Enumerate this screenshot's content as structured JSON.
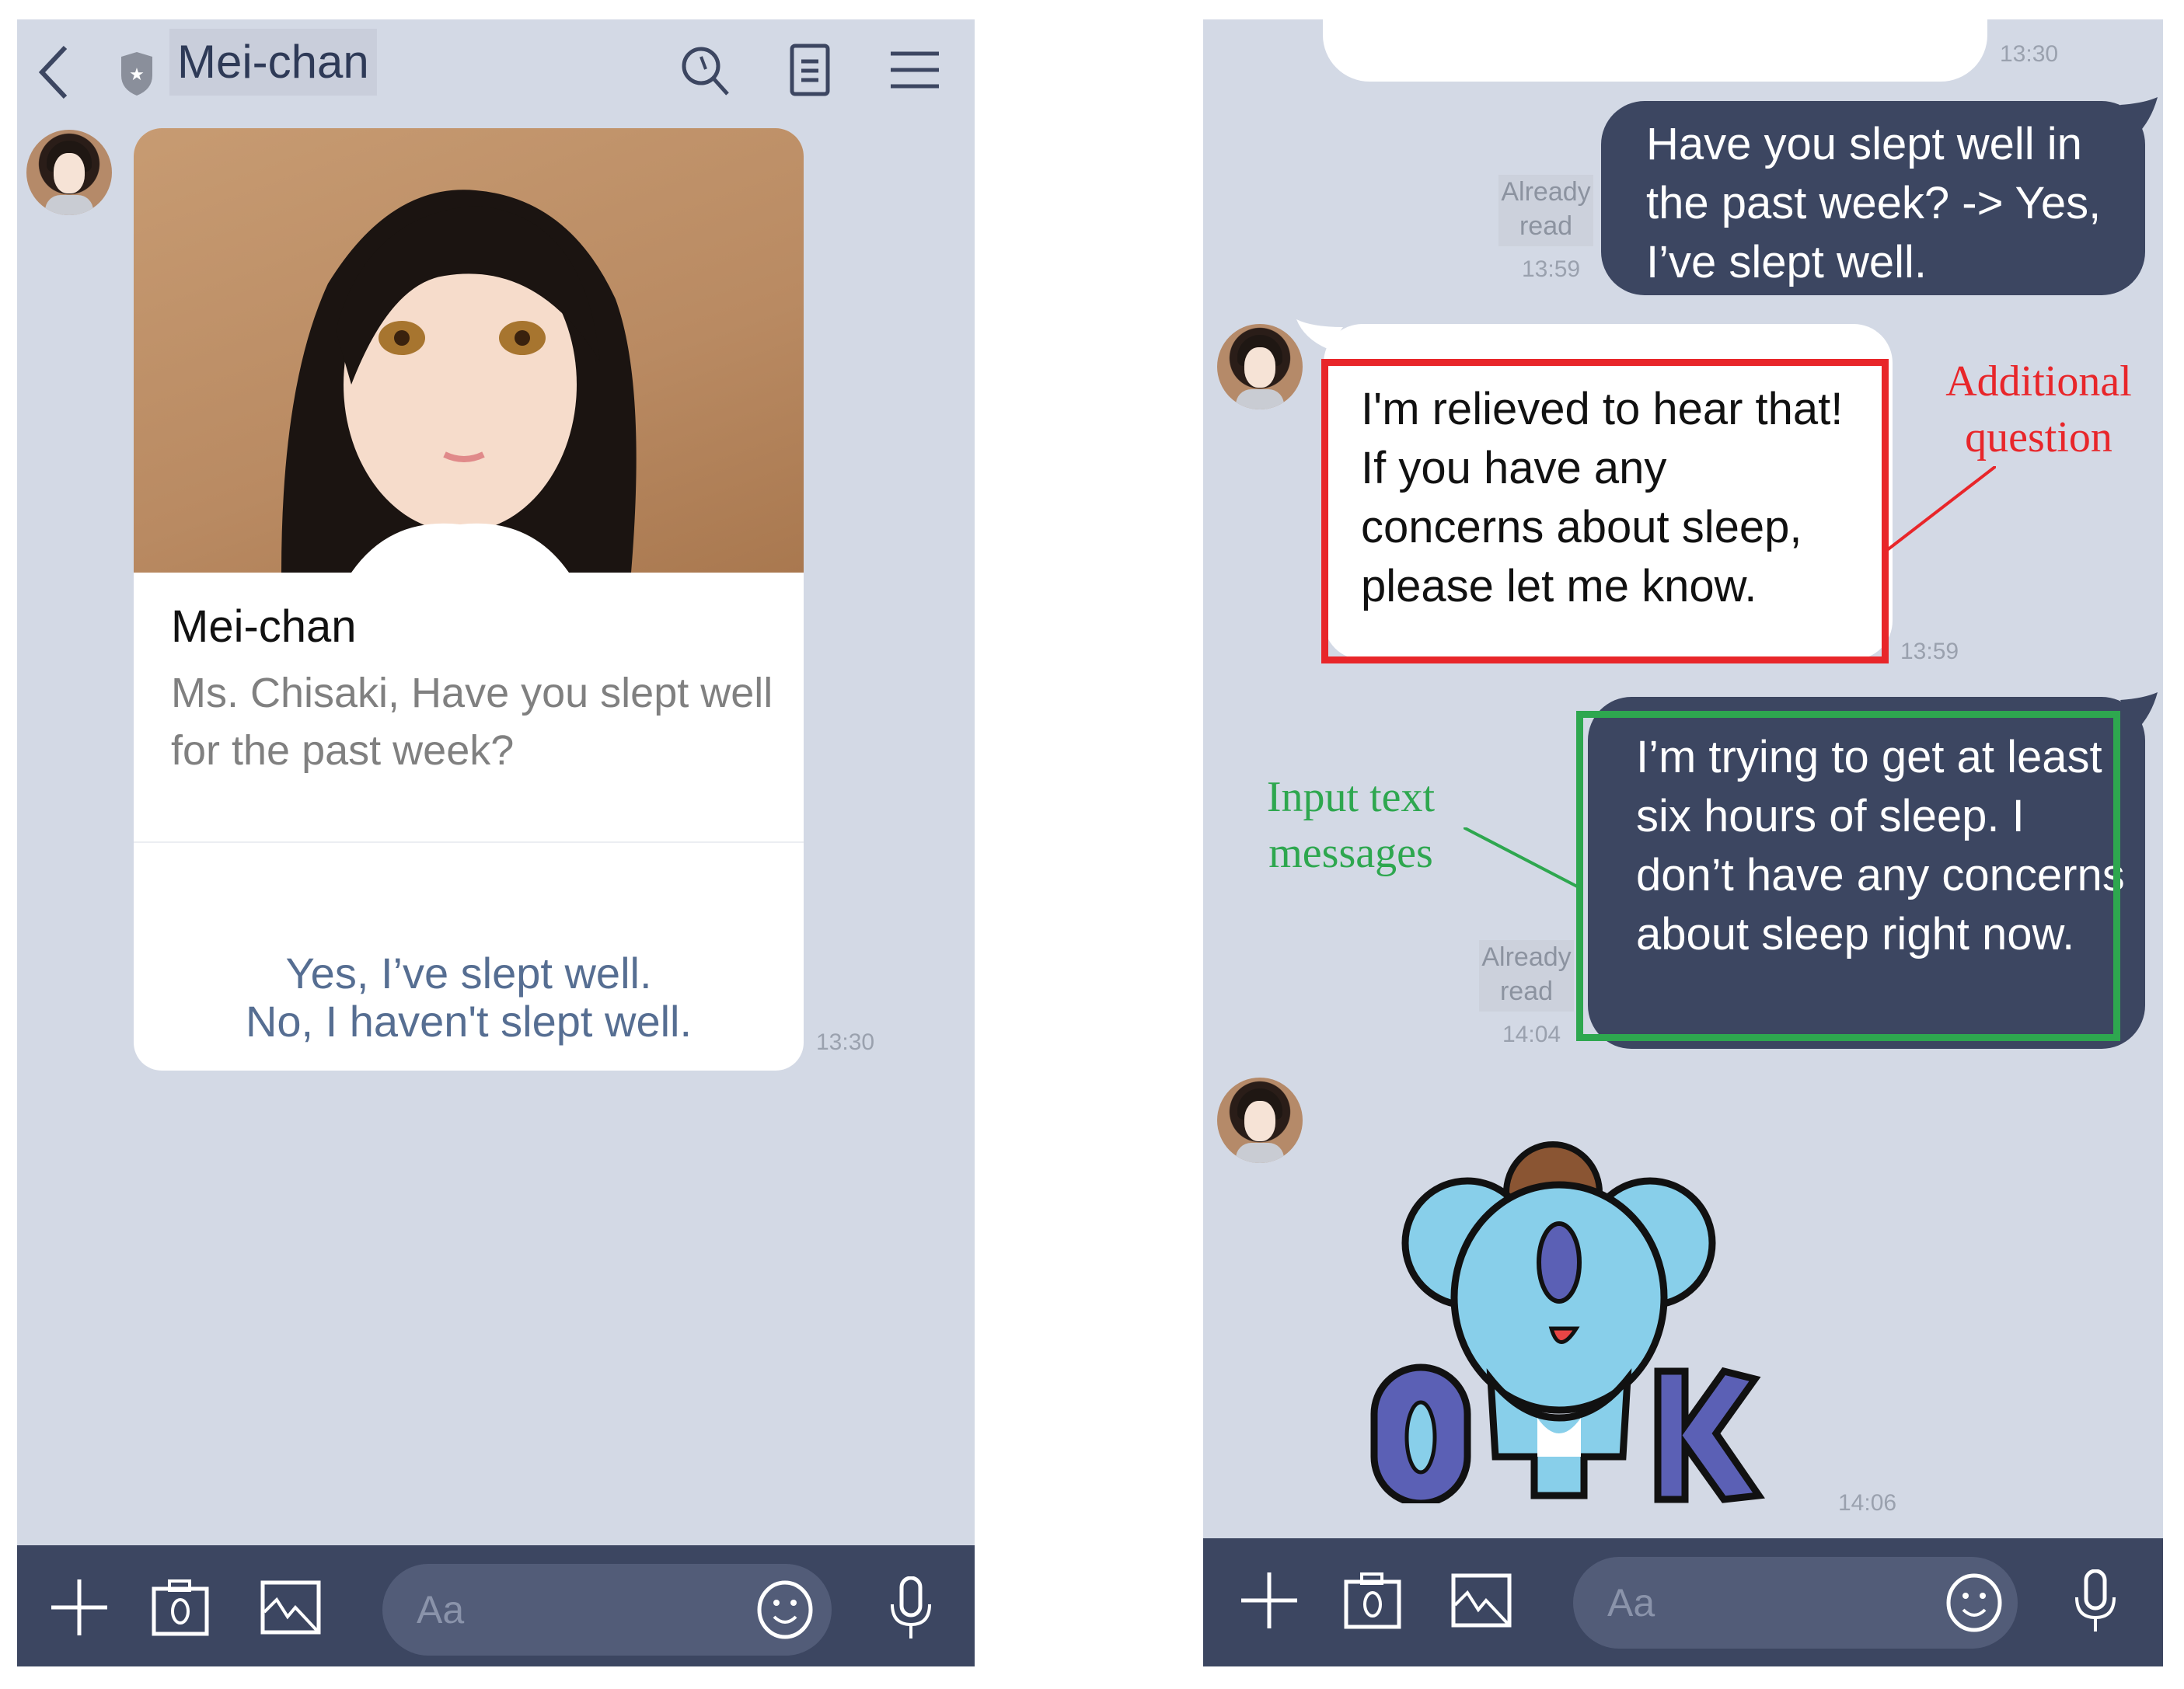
{
  "left_screen": {
    "header": {
      "back_icon": "chevron-left-icon",
      "shield_icon": "shield-icon",
      "title": "Mei-chan",
      "search_icon": "search-icon",
      "notes_icon": "notes-icon",
      "menu_icon": "menu-icon"
    },
    "card": {
      "title": "Mei-chan",
      "body": "Ms. Chisaki, Have you slept well for the past week?",
      "options": [
        "Yes, I’ve slept well.",
        "No, I haven't slept well."
      ],
      "timestamp": "13:30"
    },
    "input_bar": {
      "placeholder": "Aa",
      "icons": [
        "plus-icon",
        "camera-icon",
        "image-icon",
        "emoji-icon",
        "microphone-icon"
      ]
    }
  },
  "right_screen": {
    "messages": [
      {
        "type": "received-card-tail",
        "timestamp": "13:30"
      },
      {
        "type": "sent",
        "text": "Have you slept well in the past week? -> Yes, I’ve slept well.",
        "read_label": "Already read",
        "timestamp": "13:59"
      },
      {
        "type": "received",
        "text": "I'm relieved to hear that! If you have any concerns about sleep, please let me know.",
        "timestamp": "13:59"
      },
      {
        "type": "sent",
        "text": "I’m trying to get at least six hours of sleep. I don’t have any concerns about sleep right now.",
        "read_label": "Already read",
        "timestamp": "14:04"
      },
      {
        "type": "sticker",
        "sticker_text": "OK",
        "timestamp": "14:06"
      }
    ],
    "annotations": {
      "additional_question": "Additional question",
      "input_text_messages": "Input text messages",
      "red": "#e8262a",
      "green": "#2ea74f"
    },
    "input_bar": {
      "placeholder": "Aa",
      "icons": [
        "plus-icon",
        "camera-icon",
        "image-icon",
        "emoji-icon",
        "microphone-icon"
      ]
    }
  },
  "colors": {
    "chat_bg": "#d3d9e5",
    "sent_bubble": "#3c4661",
    "received_bubble": "#ffffff",
    "option_text": "#566e92"
  }
}
